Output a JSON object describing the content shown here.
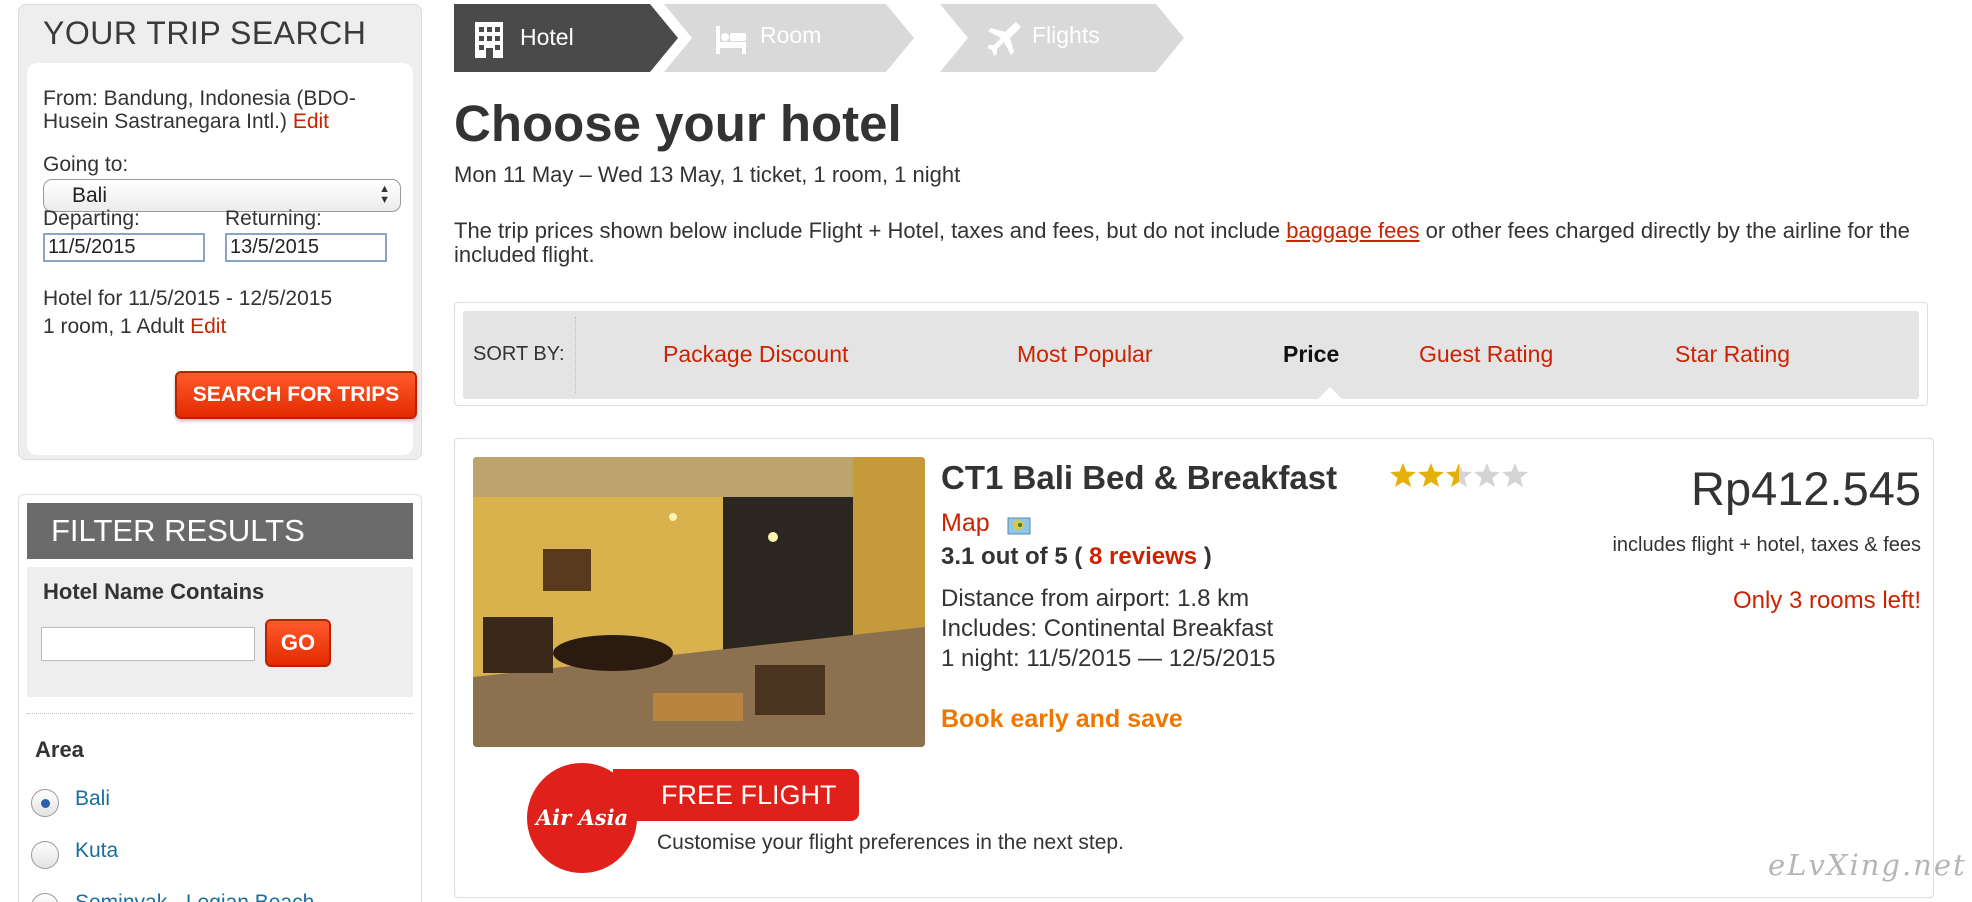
{
  "search": {
    "title": "YOUR TRIP SEARCH",
    "from_label": "From: Bandung, Indonesia (BDO-Husein Sastranegara Intl.)",
    "from_edit": "Edit",
    "going_to_label": "Going to:",
    "going_to_value": "Bali",
    "departing_label": "Departing:",
    "returning_label": "Returning:",
    "departing_value": "11/5/2015",
    "returning_value": "13/5/2015",
    "hotel_for": "Hotel for 11/5/2015 - 12/5/2015",
    "rooms_guests": "1 room, 1 Adult",
    "rooms_edit": "Edit",
    "search_button": "SEARCH FOR TRIPS"
  },
  "filter": {
    "title": "FILTER RESULTS",
    "hotel_name_label": "Hotel Name Contains",
    "hotel_name_value": "",
    "go_button": "GO",
    "area_label": "Area",
    "areas": [
      {
        "label": "Bali",
        "checked": true
      },
      {
        "label": "Kuta",
        "checked": false
      },
      {
        "label": "Seminyak - Legian Beach",
        "checked": false
      }
    ]
  },
  "steps": [
    {
      "label": "Hotel",
      "icon": "building-icon",
      "active": true
    },
    {
      "label": "Room",
      "icon": "bed-icon",
      "active": false
    },
    {
      "label": "Flights",
      "icon": "airplane-icon",
      "active": false
    }
  ],
  "main": {
    "title": "Choose your hotel",
    "summary": "Mon 11 May – Wed 13 May, 1 ticket, 1 room, 1 night",
    "note_before": "The trip prices shown below include Flight + Hotel, taxes and fees, but do not include ",
    "note_link": "baggage fees",
    "note_after": " or other fees charged directly by the airline for the included flight."
  },
  "sort": {
    "label": "SORT BY:",
    "options": [
      "Package Discount",
      "Most Popular",
      "Price",
      "Guest Rating",
      "Star Rating"
    ],
    "active": "Price"
  },
  "result": {
    "name": "CT1 Bali Bed & Breakfast",
    "star_rating": 2.5,
    "star_max": 5,
    "map_label": "Map",
    "rating_prefix": "3.1 out of 5 ( ",
    "reviews": "8 reviews",
    "rating_suffix": " )",
    "distance": "Distance from airport: 1.8 km",
    "includes": "Includes: Continental Breakfast",
    "night": "1 night: 11/5/2015 — 12/5/2015",
    "book_early": "Book early and save",
    "price": "Rp412.545",
    "price_includes": "includes flight + hotel, taxes & fees",
    "rooms_left": "Only 3 rooms left!",
    "airline_logo": "Air Asia",
    "free_flight": "FREE FLIGHT",
    "customise": "Customise your flight preferences in the next step."
  },
  "watermark": "eLvXing.net",
  "colors": {
    "accent_red": "#cc2200",
    "button_red": "#e22b00",
    "step_active": "#4a4a4a",
    "step_inactive": "#d9d9d9",
    "orange": "#ee7700",
    "airasia_red": "#e0201b",
    "star_gold": "#e5b00a"
  }
}
